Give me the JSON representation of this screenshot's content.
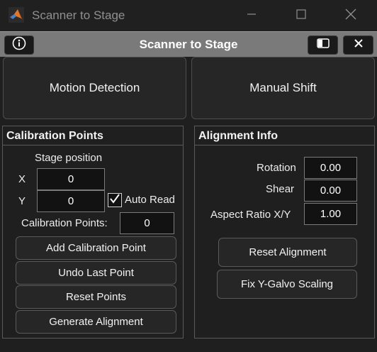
{
  "window": {
    "title": "Scanner to Stage"
  },
  "app_header": {
    "title": "Scanner to Stage"
  },
  "top_buttons": {
    "motion_detection": "Motion Detection",
    "manual_shift": "Manual Shift"
  },
  "calibration": {
    "title": "Calibration Points",
    "stage_position_label": "Stage position",
    "x_label": "X",
    "y_label": "Y",
    "x_value": "0",
    "y_value": "0",
    "auto_read_label": "Auto Read",
    "auto_read_checked": true,
    "calibration_points_label": "Calibration Points:",
    "calibration_points_value": "0",
    "buttons": {
      "add": "Add Calibration Point",
      "undo": "Undo Last Point",
      "reset": "Reset Points",
      "generate": "Generate Alignment"
    }
  },
  "alignment": {
    "title": "Alignment Info",
    "rotation_label": "Rotation",
    "rotation_value": "0.00",
    "shear_label": "Shear",
    "shear_value": "0.00",
    "aspect_label": "Aspect Ratio X/Y",
    "aspect_value": "1.00",
    "buttons": {
      "reset": "Reset Alignment",
      "fix": "Fix Y-Galvo Scaling"
    }
  },
  "icons": {
    "logo": "matlab-logo-icon",
    "info": "info-icon",
    "panel": "panel-toggle-icon",
    "close": "close-icon"
  }
}
